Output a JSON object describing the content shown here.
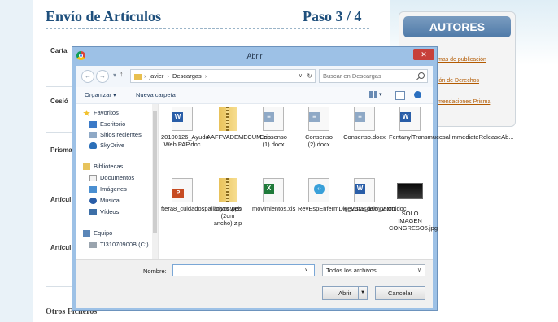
{
  "page": {
    "title": "Envío de Artículos",
    "step": "Paso 3 / 4",
    "labels": [
      "Carta",
      "Cesió",
      "Prisma",
      "Artícul",
      "Artícul"
    ],
    "otros": "Otros Ficheros",
    "authors": {
      "header": "AUTORES",
      "links": [
        "mas de publicación",
        "ión de Derechos",
        "mendaciones Prisma"
      ]
    }
  },
  "dialog": {
    "title": "Abrir",
    "close_label": "✕",
    "path": [
      "javier",
      "Descargas"
    ],
    "search_placeholder": "Buscar en Descargas",
    "toolbar": {
      "organize": "Organizar ▾",
      "new_folder": "Nueva carpeta"
    },
    "nav": {
      "favorites": "Favoritos",
      "favorites_items": [
        "Escritorio",
        "Sitios recientes",
        "SkyDrive"
      ],
      "libraries": "Bibliotecas",
      "libraries_items": [
        "Documentos",
        "Imágenes",
        "Música",
        "Vídeos"
      ],
      "computer": "Equipo",
      "computer_items": [
        "TI31070900B (C:)"
      ]
    },
    "files_row1": [
      {
        "name": "20100126_Ayuda Web PAP.doc",
        "icon": "word-icon"
      },
      {
        "name": "AAFFVADEMECUM.zip",
        "icon": "zip-icon"
      },
      {
        "name": "Consenso (1).docx",
        "icon": "docx-icon"
      },
      {
        "name": "Consenso (2).docx",
        "icon": "docx-icon"
      },
      {
        "name": "Consenso.docx",
        "icon": "docx-icon"
      },
      {
        "name": "FentanylTransmucosalImmediateReleaseAb...",
        "icon": "word-icon"
      }
    ],
    "files_row2": [
      {
        "name": "ftera8_cuidadospaliativos.pps",
        "icon": "pps-icon"
      },
      {
        "name": "logos web (2cm ancho).zip",
        "icon": "zip-icon"
      },
      {
        "name": "movimientos.xls",
        "icon": "xls-icon"
      },
      {
        "name": "RevEspEnfermDig_2013_105_2.xml",
        "icon": "xml-icon"
      },
      {
        "name": "Revistasdeimpacto.doc",
        "icon": "word-icon"
      },
      {
        "name": "SOLO IMAGEN CONGRESO5.jpg",
        "icon": "image-icon"
      }
    ],
    "file_name_label": "Nombre:",
    "file_name_value": "",
    "filter": "Todos los archivos",
    "open_button": "Abrir",
    "cancel_button": "Cancelar"
  }
}
